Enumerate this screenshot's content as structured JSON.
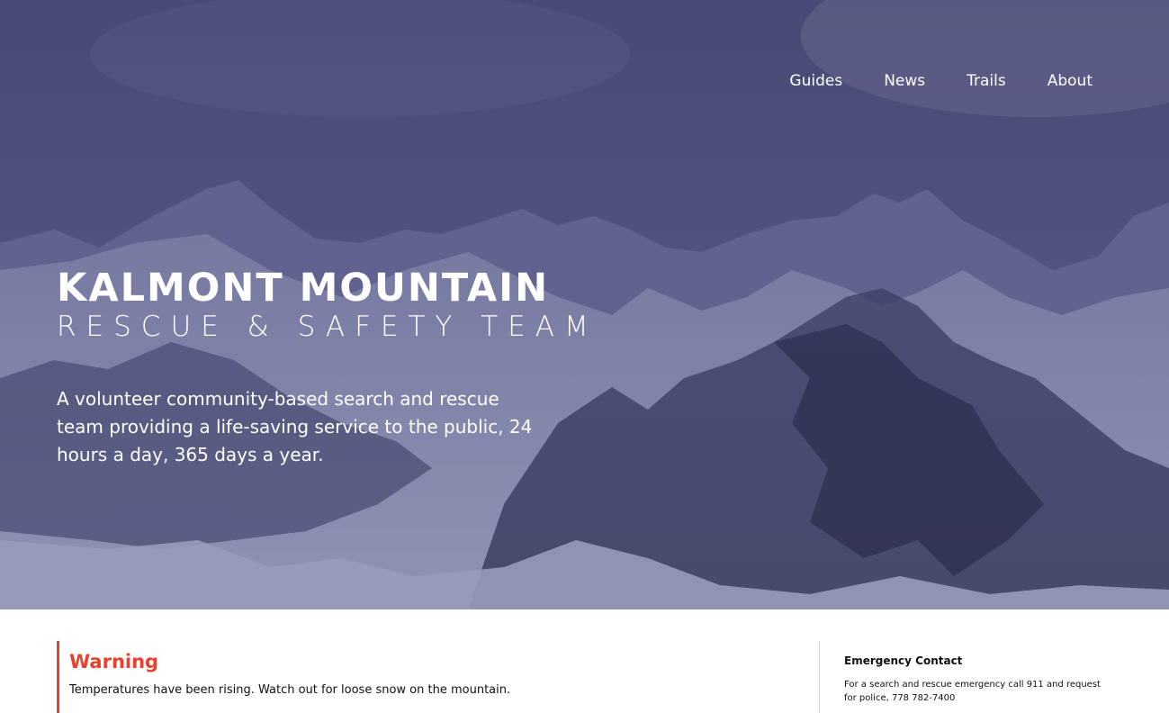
{
  "nav": {
    "items": [
      {
        "label": "Guides"
      },
      {
        "label": "News"
      },
      {
        "label": "Trails"
      },
      {
        "label": "About"
      }
    ]
  },
  "hero": {
    "title": "KALMONT  MOUNTAIN",
    "subtitle": "RESCUE & SAFETY TEAM",
    "tagline": "A volunteer community-based search and rescue team providing a life-saving service to the public, 24 hours a day, 365 days a year."
  },
  "warning": {
    "title": "Warning",
    "text": "Temperatures have been rising. Watch out for loose snow on the mountain.",
    "accent_color": "#e8412d"
  },
  "contact": {
    "title": "Emergency Contact",
    "text": "For a search and rescue emergency call 911 and request for police, 778 782-7400"
  }
}
